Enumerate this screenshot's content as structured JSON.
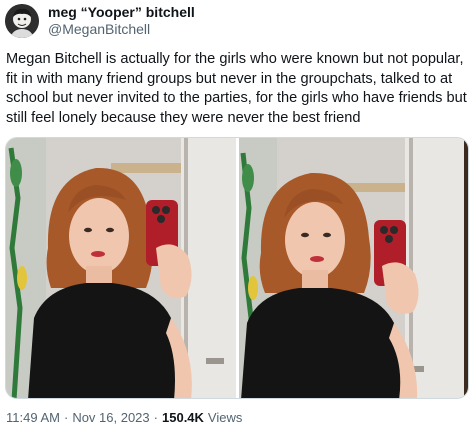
{
  "author": {
    "display_name": "meg “Yooper” bitchell",
    "handle": "@MeganBitchell"
  },
  "tweet": {
    "text": "Megan Bitchell is actually for the girls who were known but not popular, fit in with many friend groups but never in the groupchats, talked to at school but never invited to the parties, for the girls who have friends but still feel lonely because they were never the best friend"
  },
  "media": {
    "photos": [
      {
        "label": "mirror selfie photo 1"
      },
      {
        "label": "mirror selfie photo 2"
      }
    ]
  },
  "meta": {
    "time": "11:49 AM",
    "separator": "·",
    "date": "Nov 16, 2023",
    "views_count": "150.4K",
    "views_label": "Views"
  }
}
